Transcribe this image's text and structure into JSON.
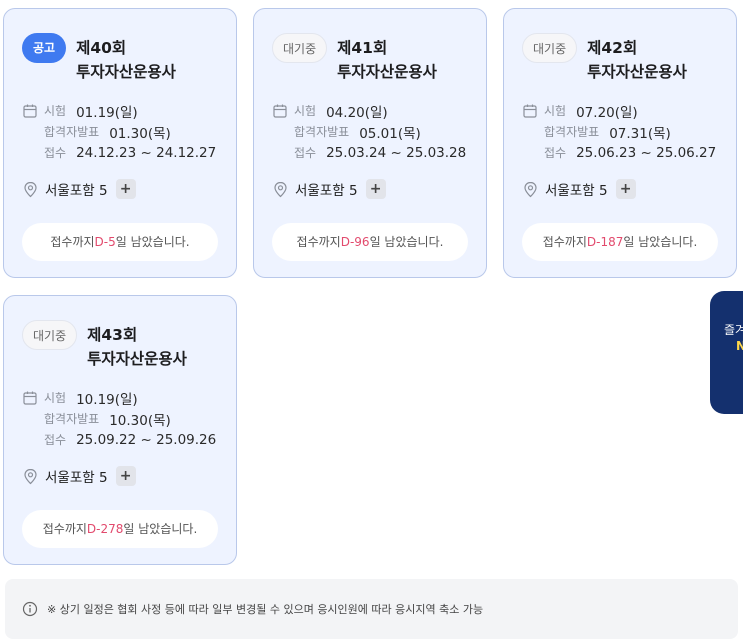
{
  "cards": [
    {
      "badge": "공고",
      "title": "제40회 투자자산운용사",
      "exam_label": "시험",
      "exam_value": "01.19(일)",
      "result_label": "합격자발표",
      "result_value": "01.30(목)",
      "apply_label": "접수",
      "apply_value": "24.12.23 ~ 24.12.27",
      "location": "서울포함 5",
      "plus": "+",
      "dday_prefix": "접수까지",
      "dday_value": "D-5",
      "dday_suffix": "일 남았습니다."
    },
    {
      "badge": "대기중",
      "title": "제41회 투자자산운용사",
      "exam_label": "시험",
      "exam_value": "04.20(일)",
      "result_label": "합격자발표",
      "result_value": "05.01(목)",
      "apply_label": "접수",
      "apply_value": "25.03.24 ~ 25.03.28",
      "location": "서울포함 5",
      "plus": "+",
      "dday_prefix": "접수까지",
      "dday_value": "D-96",
      "dday_suffix": "일 남았습니다."
    },
    {
      "badge": "대기중",
      "title": "제42회 투자자산운용사",
      "exam_label": "시험",
      "exam_value": "07.20(일)",
      "result_label": "합격자발표",
      "result_value": "07.31(목)",
      "apply_label": "접수",
      "apply_value": "25.06.23 ~ 25.06.27",
      "location": "서울포함 5",
      "plus": "+",
      "dday_prefix": "접수까지",
      "dday_value": "D-187",
      "dday_suffix": "일 남았습니다."
    },
    {
      "badge": "대기중",
      "title": "제43회 투자자산운용사",
      "exam_label": "시험",
      "exam_value": "10.19(일)",
      "result_label": "합격자발표",
      "result_value": "10.30(목)",
      "apply_label": "접수",
      "apply_value": "25.09.22 ~ 25.09.26",
      "location": "서울포함 5",
      "plus": "+",
      "dday_prefix": "접수까지",
      "dday_value": "D-278",
      "dday_suffix": "일 남았습니다."
    }
  ],
  "floating_panel": {
    "line1": "즐겨",
    "line2": "N"
  },
  "notice": "※ 상기 일정은 협회 사정 등에 따라 일부 변경될 수 있으며 응시인원에 따라 응시지역 축소 가능",
  "colors": {
    "card_bg": "#eef3ff",
    "card_border": "#b9c8ea",
    "badge_notice": "#3f7af0",
    "dday_accent": "#e24a6d",
    "panel_bg": "#14306e"
  },
  "icons": {
    "calendar": "calendar-icon",
    "location": "location-pin-icon",
    "info": "info-circle-icon"
  }
}
